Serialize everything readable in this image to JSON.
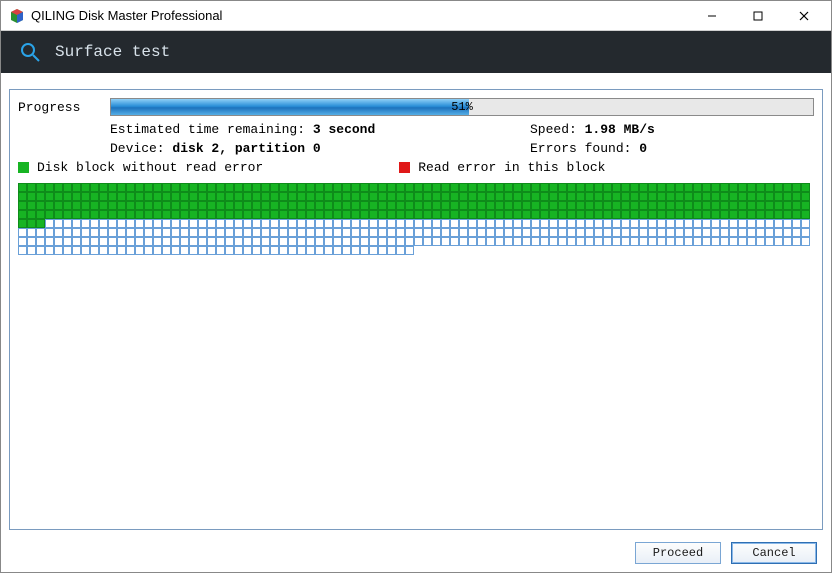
{
  "window": {
    "title": "QILING Disk Master Professional"
  },
  "header": {
    "title": "Surface test"
  },
  "progress": {
    "label": "Progress",
    "percent": 51,
    "percent_text": "51%"
  },
  "info": {
    "eta_label": "Estimated time remaining:",
    "eta_value": "3 second",
    "speed_label": "Speed:",
    "speed_value": "1.98 MB/s",
    "device_label": "Device:",
    "device_value": "disk 2, partition 0",
    "errors_label": "Errors found:",
    "errors_value": "0"
  },
  "legend": {
    "ok": "Disk block without read error",
    "err": "Read error in this block"
  },
  "grid": {
    "cols": 88,
    "rows": 8,
    "filled_rows": 4,
    "extra_filled_in_row5": 3,
    "last_partial_row_cols": 44
  },
  "buttons": {
    "proceed": "Proceed",
    "cancel": "Cancel"
  }
}
